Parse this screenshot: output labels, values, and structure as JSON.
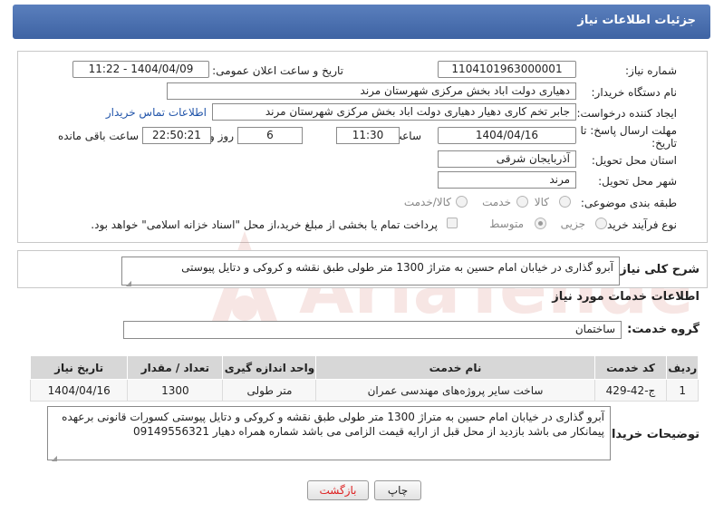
{
  "header": {
    "title": "جزئیات اطلاعات نیاز"
  },
  "form": {
    "need_number": {
      "label": "شماره نیاز:",
      "value": "1104101963000001"
    },
    "announce_datetime": {
      "label": "تاریخ و ساعت اعلان عمومی:",
      "value": "1404/04/09 - 11:22"
    },
    "buyer_org": {
      "label": "نام دستگاه خریدار:",
      "value": "دهیاری دولت اباد بخش مرکزی شهرستان مرند"
    },
    "request_creator": {
      "label": "ایجاد کننده درخواست:",
      "value": "جابر تخم کاری دهیار دهیاری دولت اباد بخش مرکزی شهرستان مرند",
      "contact_link": "اطلاعات تماس خریدار"
    },
    "deadline": {
      "label_line1": "مهلت ارسال پاسخ: تا",
      "label_line2": "تاریخ:",
      "date": "1404/04/16",
      "time_label": "ساعت",
      "time": "11:30",
      "days_value": "6",
      "days_label": "روز و",
      "remaining_time": "22:50:21",
      "remaining_label": "ساعت باقی مانده"
    },
    "province": {
      "label": "استان محل تحویل:",
      "value": "آذربایجان شرقی"
    },
    "city": {
      "label": "شهر محل تحویل:",
      "value": "مرند"
    },
    "category": {
      "label": "طبقه بندی موضوعی:",
      "options": [
        {
          "label": "کالا",
          "checked": false
        },
        {
          "label": "خدمت",
          "checked": false
        },
        {
          "label": "کالا/خدمت",
          "checked": false
        }
      ]
    },
    "purchase_type": {
      "label": "نوع فرآیند خرید :",
      "options": [
        {
          "label": "جزیی",
          "checked": false
        },
        {
          "label": "متوسط",
          "checked": true
        }
      ],
      "payment_note": "پرداخت تمام یا بخشی از مبلغ خرید،از محل \"اسناد خزانه اسلامی\" خواهد بود."
    }
  },
  "summary": {
    "label": "شرح کلی نیاز:",
    "text": "آبرو گذاری  در خیابان امام حسین به متراژ 1300 متر طولی  طبق نقشه و کروکی و دتایل پیوستی"
  },
  "services": {
    "section_title": "اطلاعات خدمات مورد نیاز",
    "group_label": "گروه خدمت:",
    "group_value": "ساختمان",
    "columns": [
      "ردیف",
      "کد خدمت",
      "نام خدمت",
      "واحد اندازه گیری",
      "تعداد / مقدار",
      "تاریخ نیاز"
    ],
    "rows": [
      {
        "row": "1",
        "code": "ج-42-429",
        "name": "ساخت سایر پروژه‌های مهندسی عمران",
        "unit": "متر طولی",
        "qty": "1300",
        "date": "1404/04/16"
      }
    ]
  },
  "buyer_notes": {
    "label": "توضیحات خریدار:",
    "line1": "آبرو گذاری  در خیابان امام حسین به متراژ 1300 متر طولی  طبق نقشه و کروکی و دتایل پیوستی کسورات قانونی برعهده",
    "line2": "پیمانکار می باشد بازدید از محل قبل از ارایه قیمت الزامی می باشد شماره همراه دهیار 09149556321"
  },
  "buttons": {
    "print": "چاپ",
    "back": "بازگشت"
  },
  "watermark": {
    "text": "AriaTender.net"
  },
  "colors": {
    "header": "#4a6fb0",
    "link": "#2255aa",
    "back_text": "#dd2222"
  }
}
